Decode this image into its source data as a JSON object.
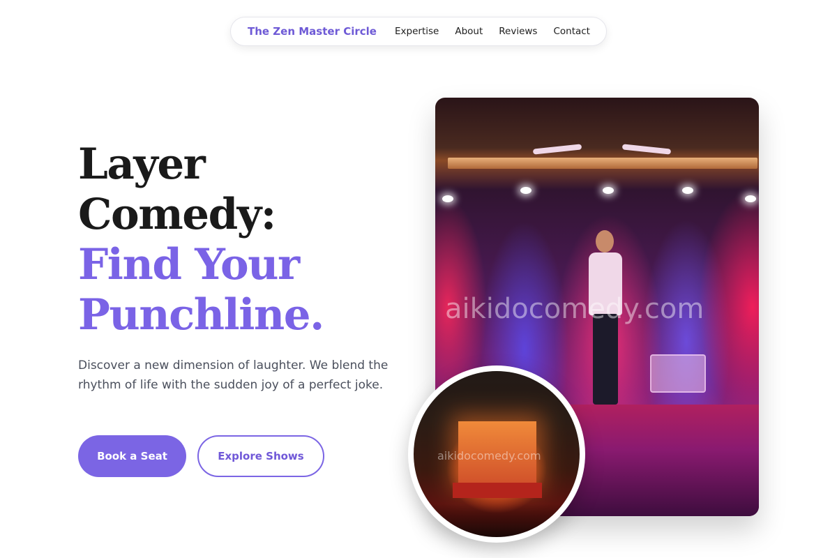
{
  "nav": {
    "brand": "The Zen Master Circle",
    "links": [
      "Expertise",
      "About",
      "Reviews",
      "Contact"
    ]
  },
  "hero": {
    "headline_line1": "Layer",
    "headline_line2": "Comedy:",
    "headline_accent_line1": "Find Your",
    "headline_accent_line2": "Punchline.",
    "description": "Discover a new dimension of laughter. We blend the rhythm of life with the sudden joy of a perfect joke.",
    "primary_cta": "Book a Seat",
    "secondary_cta": "Explore Shows"
  },
  "media": {
    "main_watermark": "aikidocomedy.com",
    "inset_watermark": "aikidocomedy.com"
  },
  "colors": {
    "accent": "#7b65e4",
    "text_dark": "#1a1a1a",
    "text_muted": "#4a4f5c"
  }
}
